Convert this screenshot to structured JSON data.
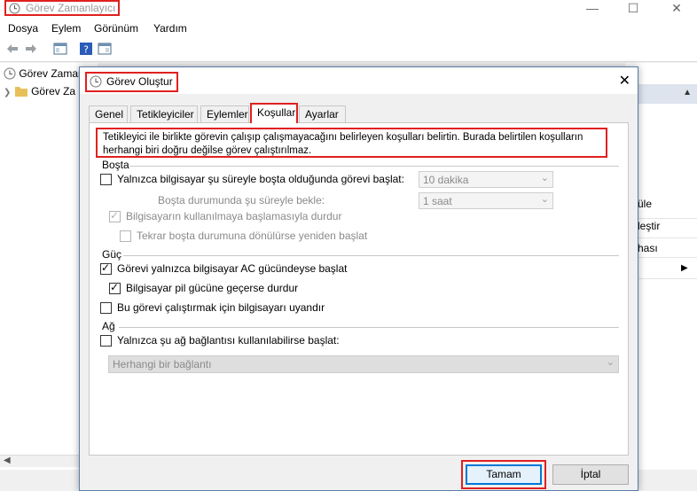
{
  "app": {
    "title": "Görev Zamanlayıcı"
  },
  "menu": {
    "items": [
      "Dosya",
      "Eylem",
      "Görünüm",
      "Yardım"
    ]
  },
  "tree": {
    "items": [
      "Görev Zamanl",
      "Görev Za"
    ]
  },
  "right_pane": {
    "items": [
      "üle",
      "leştir",
      "hası"
    ]
  },
  "dialog": {
    "title": "Görev Oluştur",
    "tabs": [
      "Genel",
      "Tetikleyiciler",
      "Eylemler",
      "Koşullar",
      "Ayarlar"
    ],
    "active_tab": "Koşullar",
    "description": "Tetikleyici ile birlikte görevin çalışıp çalışmayacağını belirleyen koşulları belirtin. Burada belirtilen koşulların herhangi biri doğru değilse görev çalıştırılmaz.",
    "idle": {
      "group_label": "Boşta",
      "start_idle_label": "Yalnızca bilgisayar şu süreyle boşta olduğunda görevi başlat:",
      "start_idle_checked": false,
      "idle_duration_value": "10 dakika",
      "wait_label": "Boşta durumunda şu süreyle bekle:",
      "wait_value": "1 saat",
      "stop_on_use_label": "Bilgisayarın kullanılmaya başlamasıyla durdur",
      "stop_on_use_checked": true,
      "restart_label": "Tekrar boşta durumuna dönülürse yeniden başlat",
      "restart_checked": false
    },
    "power": {
      "group_label": "Güç",
      "ac_label": "Görevi yalnızca bilgisayar AC gücündeyse başlat",
      "ac_checked": true,
      "battery_stop_label": "Bilgisayar pil gücüne geçerse durdur",
      "battery_stop_checked": true,
      "wake_label": "Bu görevi çalıştırmak için bilgisayarı uyandır",
      "wake_checked": false
    },
    "network": {
      "group_label": "Ağ",
      "connection_label": "Yalnızca şu ağ bağlantısı kullanılabilirse başlat:",
      "connection_checked": false,
      "connection_value": "Herhangi bir bağlantı"
    },
    "buttons": {
      "ok": "Tamam",
      "cancel": "İptal"
    }
  },
  "colors": {
    "highlight": "#e02020",
    "accent": "#0078d7"
  }
}
